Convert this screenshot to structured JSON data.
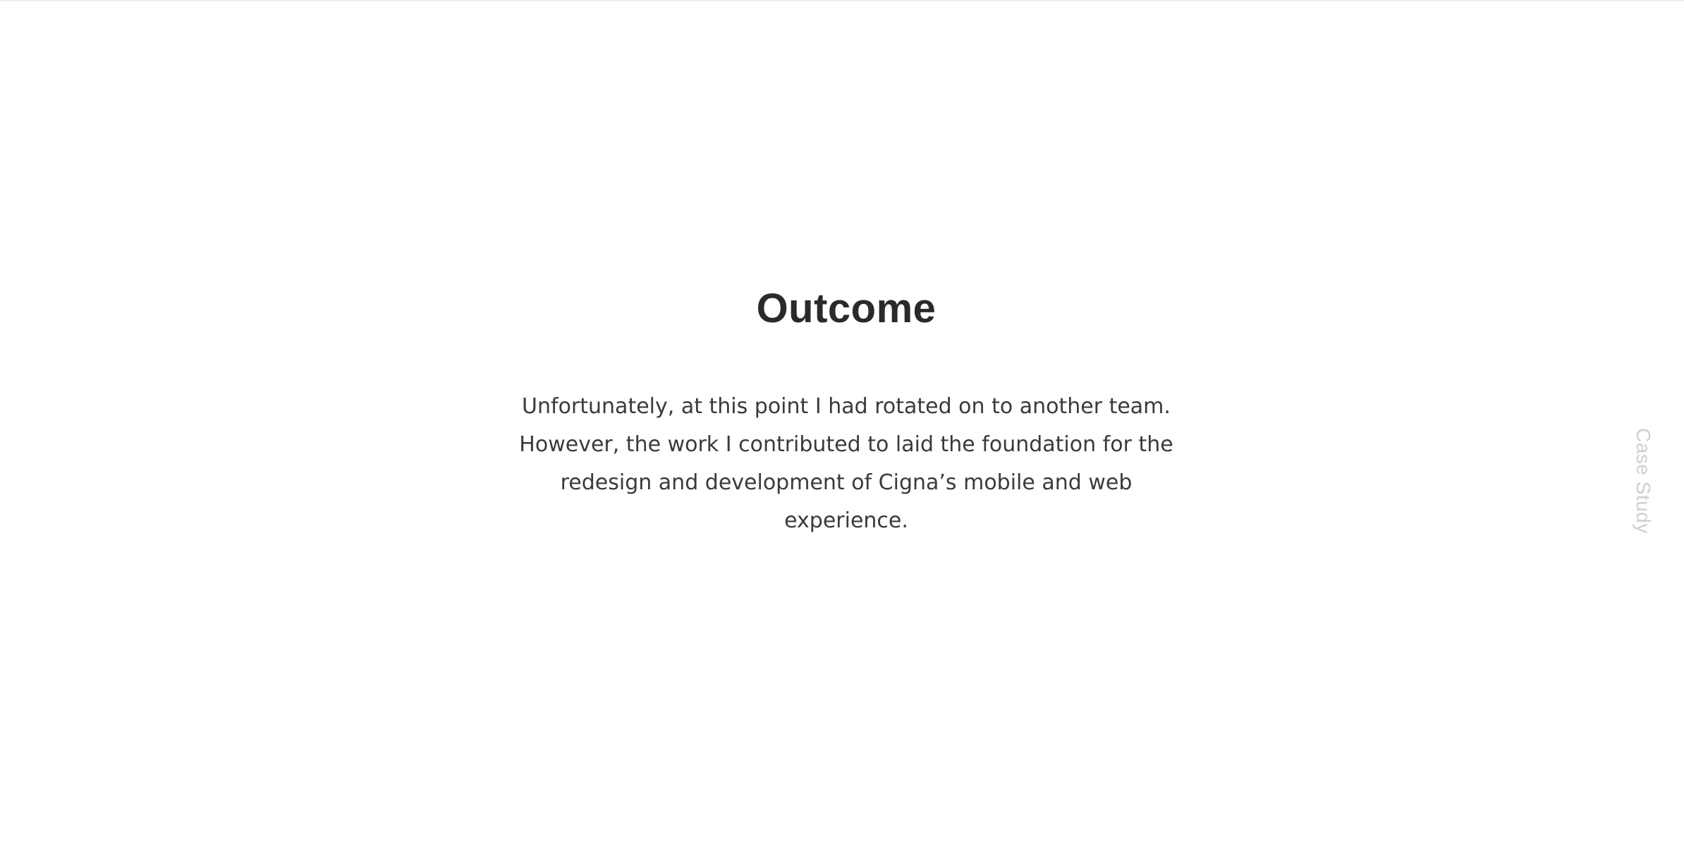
{
  "outcome": {
    "title": "Outcome",
    "body": "Unfortunately, at this point I had rotated on to another team. However, the work I contributed to laid the foundation for the redesign and development of Cigna’s mobile and web experience."
  },
  "side_nav": {
    "label": "Case Study"
  },
  "colors": {
    "background": "#ffffff",
    "title": "#2a2a2a",
    "body": "#3a3a3a",
    "side_label": "#cfcfcf"
  }
}
